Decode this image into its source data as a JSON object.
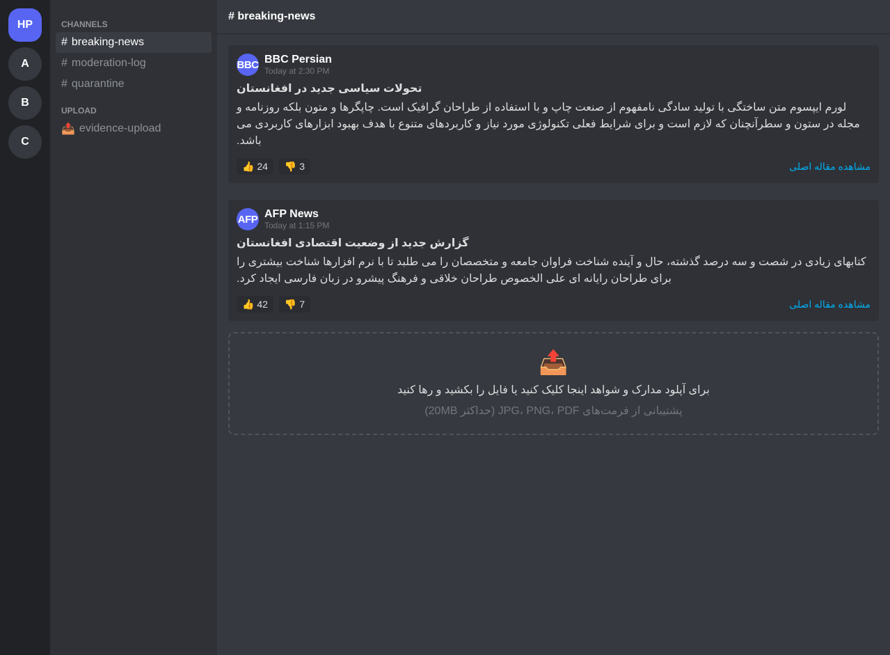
{
  "servers": [
    {
      "label": "HP",
      "active": true
    },
    {
      "label": "A"
    },
    {
      "label": "B"
    },
    {
      "label": "C"
    }
  ],
  "sidebar": {
    "channels_label": "CHANNELS",
    "channels": [
      {
        "hash": "#",
        "name": "breaking-news",
        "active": true
      },
      {
        "hash": "#",
        "name": "moderation-log"
      },
      {
        "hash": "#",
        "name": "quarantine"
      }
    ],
    "upload_label": "UPLOAD",
    "upload_channel": {
      "icon": "📤",
      "name": "evidence-upload"
    }
  },
  "header": {
    "title": "# breaking-news"
  },
  "messages": [
    {
      "avatar": "BBC",
      "author": "BBC Persian",
      "timestamp": "Today at 2:30 PM",
      "headline": "تحولات سیاسی جدید در افغانستان",
      "body": "لورم ایپسوم متن ساختگی با تولید سادگی نامفهوم از صنعت چاپ و با استفاده از طراحان گرافیک است. چاپگرها و متون بلکه روزنامه و مجله در ستون و سطرآنچنان که لازم است و برای شرایط فعلی تکنولوژی مورد نیاز و کاربردهای متنوع با هدف بهبود ابزارهای کاربردی می باشد.",
      "likes": "👍 24",
      "dislikes": "👎 3",
      "link": "مشاهده مقاله اصلی"
    },
    {
      "avatar": "AFP",
      "author": "AFP News",
      "timestamp": "Today at 1:15 PM",
      "headline": "گزارش جدید از وضعیت اقتصادی افغانستان",
      "body": "کتابهای زیادی در شصت و سه درصد گذشته، حال و آینده شناخت فراوان جامعه و متخصصان را می طلبد تا با نرم افزارها شناخت بیشتری را برای طراحان رایانه ای علی الخصوص طراحان خلاقی و فرهنگ پیشرو در زبان فارسی ایجاد کرد.",
      "likes": "👍 42",
      "dislikes": "👎 7",
      "link": "مشاهده مقاله اصلی"
    }
  ],
  "upload": {
    "icon": "📤",
    "title": "برای آپلود مدارک و شواهد اینجا کلیک کنید یا فایل را بکشید و رها کنید",
    "hint": "پشتیبانی از فرمت‌های JPG، PNG، PDF (حداکثر 20MB)"
  }
}
